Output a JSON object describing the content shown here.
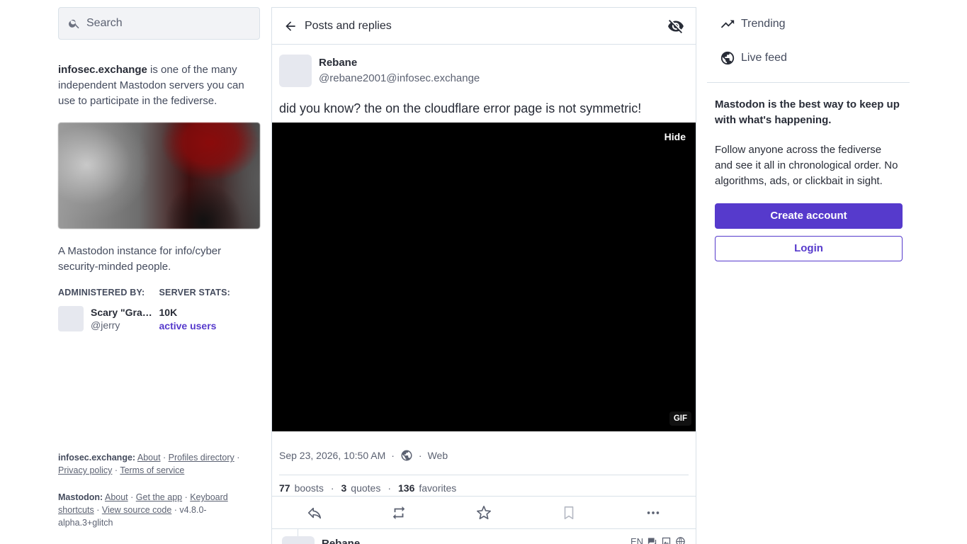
{
  "search": {
    "placeholder": "Search"
  },
  "server": {
    "domain": "infosec.exchange",
    "intro": " is one of the many independent Mastodon servers you can use to participate in the fediverse.",
    "description": "A Mastodon instance for info/cyber security-minded people.",
    "administered_by_label": "ADMINISTERED BY:",
    "server_stats_label": "SERVER STATS:",
    "admin_name": "Scary \"Grandpa\" Jerry",
    "admin_handle": "@jerry",
    "stat_value": "10K",
    "stat_label": "active users"
  },
  "footer": {
    "server_label": "infosec.exchange:",
    "server_links": [
      "About",
      "Profiles directory",
      "Privacy policy",
      "Terms of service"
    ],
    "mastodon_label": "Mastodon:",
    "mastodon_links": [
      "About",
      "Get the app",
      "Keyboard shortcuts",
      "View source code"
    ],
    "version": "v4.8.0-alpha.3+glitch"
  },
  "column": {
    "title": "Posts and replies"
  },
  "post": {
    "display_name": "Rebane",
    "handle": "@rebane2001@infosec.exchange",
    "content": "did you know? the  on the cloudflare error page is not symmetric!",
    "media_hide_label": "Hide",
    "media_badge": "GIF",
    "timestamp": "Sep 23, 2026, 10:50 AM",
    "visibility_icon": "globe-icon",
    "application": "Web",
    "boosts_count": "77",
    "boosts_label": "boosts",
    "quotes_count": "3",
    "quotes_label": "quotes",
    "favorites_count": "136",
    "favorites_label": "favorites"
  },
  "reply_peek": {
    "display_name": "Rebane",
    "language": "EN"
  },
  "right": {
    "nav": [
      {
        "label": "Trending",
        "icon": "trending-icon"
      },
      {
        "label": "Live feed",
        "icon": "globe-icon"
      }
    ],
    "promo_title": "Mastodon is the best way to keep up with what's happening.",
    "promo_body": "Follow anyone across the fediverse and see it all in chronological order. No algorithms, ads, or clickbait in sight.",
    "create_account": "Create account",
    "login": "Login"
  },
  "colors": {
    "accent": "#563acc",
    "text": "#282c37",
    "muted": "#5c6272",
    "border": "#d9e1e8"
  }
}
